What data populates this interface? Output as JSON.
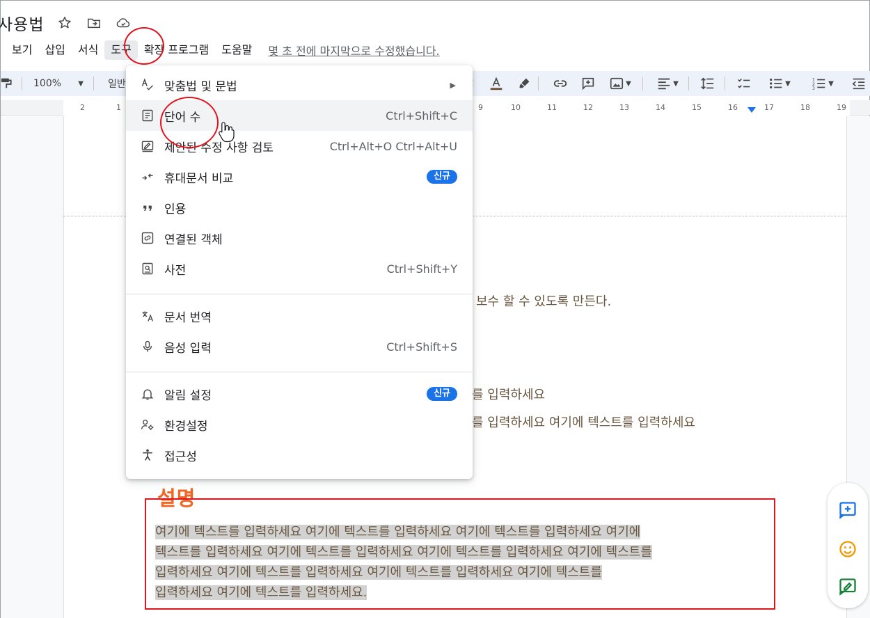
{
  "doc": {
    "title": "사용법",
    "last_edit": "몇 초 전에 마지막으로 수정했습니다."
  },
  "menubar": {
    "items": [
      "보기",
      "삽입",
      "서식",
      "도구",
      "확장 프로그램",
      "도움말"
    ],
    "active": "도구"
  },
  "toolbar": {
    "zoom": "100%",
    "style": "일반"
  },
  "ruler": {
    "labels": [
      "2",
      "1",
      "9",
      "10",
      "11",
      "12",
      "13",
      "14",
      "15",
      "16",
      "17",
      "18",
      "19"
    ]
  },
  "tools_menu": {
    "items": [
      {
        "label": "맞춤법 및 문법",
        "icon": "spellcheck-icon",
        "submenu": true
      },
      {
        "label": "단어 수",
        "icon": "word-count-icon",
        "shortcut": "Ctrl+Shift+C"
      },
      {
        "label": "제안된 수정 사항 검토",
        "icon": "review-edits-icon",
        "shortcut": "Ctrl+Alt+O Ctrl+Alt+U"
      },
      {
        "label": "휴대문서 비교",
        "icon": "compare-icon",
        "badge": "신규"
      },
      {
        "label": "인용",
        "icon": "quote-icon"
      },
      {
        "label": "연결된 객체",
        "icon": "linked-object-icon"
      },
      {
        "label": "사전",
        "icon": "dictionary-icon",
        "shortcut": "Ctrl+Shift+Y"
      },
      {
        "label": "문서 번역",
        "icon": "translate-icon"
      },
      {
        "label": "음성 입력",
        "icon": "microphone-icon",
        "shortcut": "Ctrl+Shift+S"
      },
      {
        "label": "알림 설정",
        "icon": "bell-icon",
        "badge": "신규"
      },
      {
        "label": "환경설정",
        "icon": "preferences-icon"
      },
      {
        "label": "접근성",
        "icon": "accessibility-icon"
      }
    ]
  },
  "document": {
    "line1": "보수 할 수 있도록 만든다.",
    "line2": "를 입력하세요",
    "line3": "를 입력하세요 여기에 텍스트를 입력하세요",
    "heading": "설명",
    "paragraph_lines": [
      "여기에 텍스트를 입력하세요 여기에 텍스트를 입력하세요 여기에 텍스트를 입력하세요 여기에",
      "텍스트를 입력하세요 여기에 텍스트를 입력하세요 여기에 텍스트를 입력하세요 여기에 텍스트를",
      "입력하세요 여기에 텍스트를 입력하세요 여기에 텍스트를 입력하세요 여기에 텍스트를",
      "입력하세요 여기에 텍스트를 입력하세요."
    ]
  },
  "colors": {
    "accent": "#1a73e8",
    "annotation_red": "#e0141e",
    "heading_orange": "#f26522",
    "body_text": "#6b5842"
  }
}
